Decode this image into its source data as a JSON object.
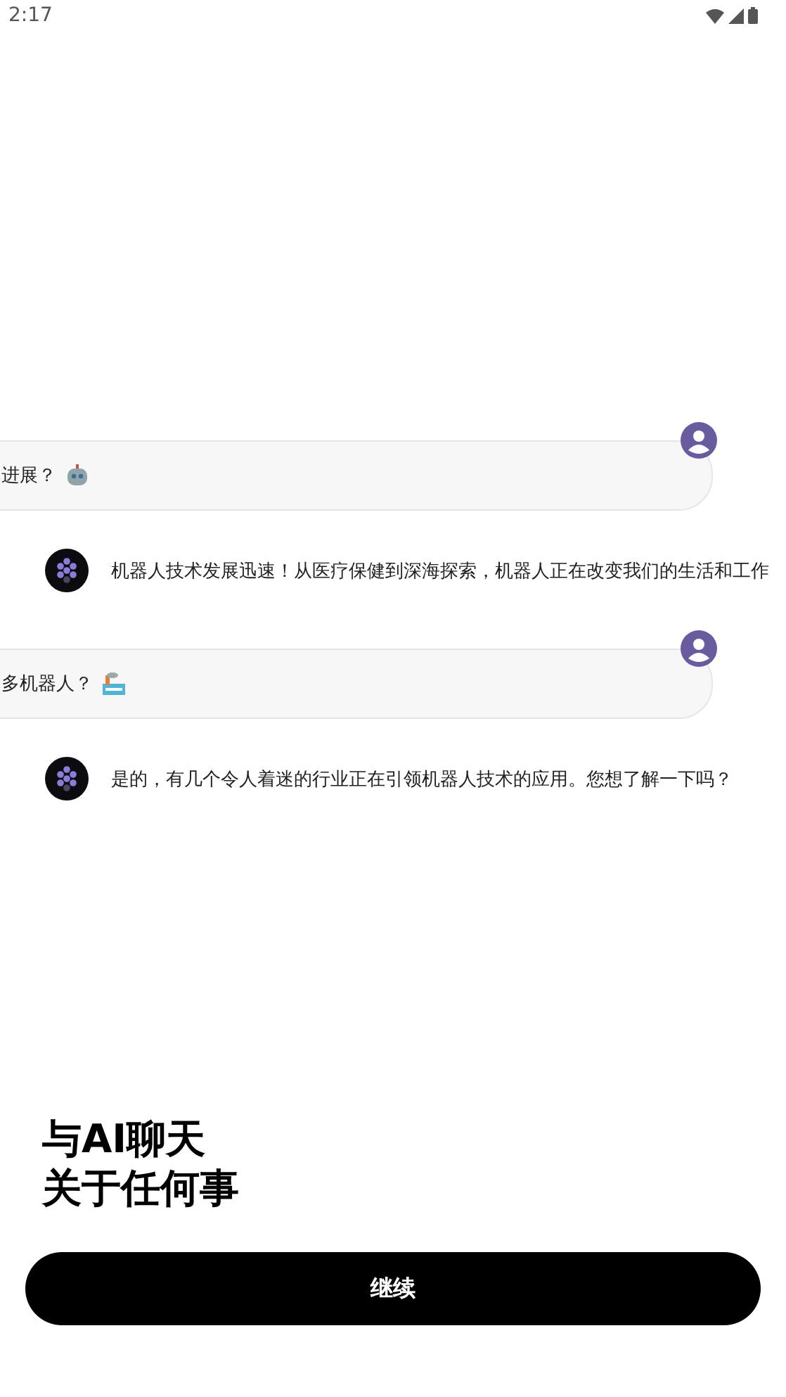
{
  "status_bar": {
    "time": "2:17"
  },
  "messages": [
    {
      "kind": "user",
      "text": "进展？",
      "icon": {
        "kind": "robot"
      }
    },
    {
      "kind": "bot",
      "text": "机器人技术发展迅速！从医疗保健到深海探索，机器人正在改变我们的生活和工作"
    },
    {
      "kind": "user",
      "text": "多机器人？",
      "icon": {
        "kind": "factory"
      }
    },
    {
      "kind": "bot",
      "text": "是的，有几个令人着迷的行业正在引领机器人技术的应用。您想了解一下吗？"
    }
  ],
  "headline": [
    "与AI聊天",
    "关于任何事"
  ],
  "continue_button": {
    "label": "继续"
  }
}
